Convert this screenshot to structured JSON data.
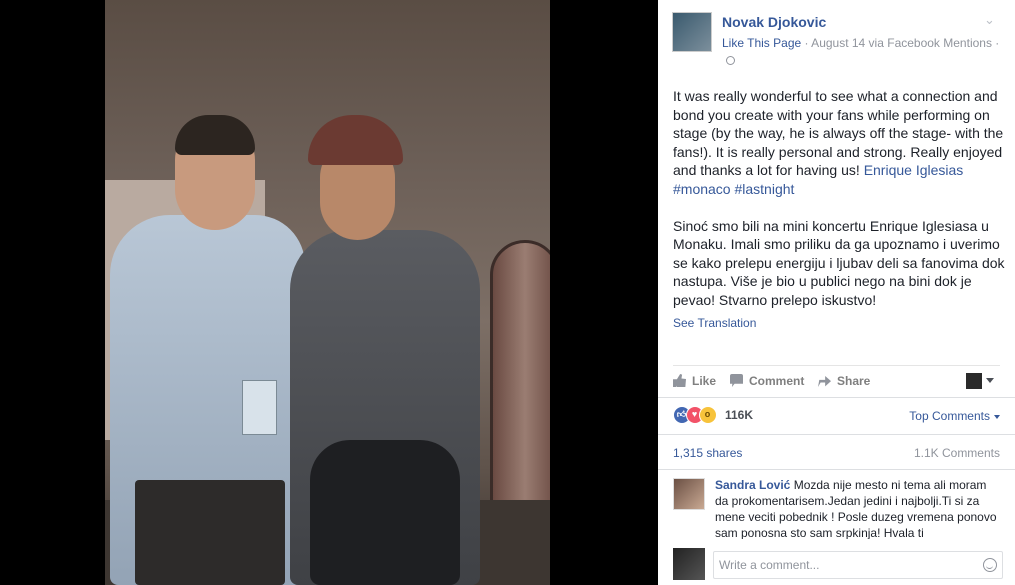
{
  "post": {
    "author": "Novak Djokovic",
    "like_page": "Like This Page",
    "meta": "· August 14 via Facebook Mentions ·",
    "text_p1_a": "It was really wonderful to see what a connection and bond you create with your fans while performing on stage (by the way, he is always off the stage- with the fans!). It is really personal and strong. Really enjoyed and thanks a lot for having us! ",
    "text_p1_link": "Enrique Iglesias #monaco #lastnight",
    "text_p2": "Sinoć smo bili na mini koncertu Enrique Iglesiasa u Monaku. Imali smo priliku da ga upoznamo i uverimo se kako prelepu energiju i ljubav deli sa fanovima dok nastupa. Više je bio u publici nego na bini dok je pevao! Stvarno prelepo iskustvo!",
    "see_translation": "See Translation"
  },
  "actions": {
    "like": "Like",
    "comment": "Comment",
    "share": "Share"
  },
  "stats": {
    "reactions_count": "116K",
    "top_comments": "Top Comments",
    "shares": "1,315 shares",
    "comments": "1.1K Comments"
  },
  "comment": {
    "author": "Sandra Lović",
    "text": " Mozda nije mesto ni tema ali moram da prokomentarisem.Jedan jedini i najbolji.Ti si za mene veciti pobednik ! Posle duzeg vremena ponovo sam ponosna sto sam srpkinja! Hvala ti"
  },
  "composer": {
    "placeholder": "Write a comment..."
  },
  "icons": {
    "reaction_like": "thumbs-up-icon",
    "reaction_love": "heart-icon",
    "reaction_wow": "wow-icon"
  },
  "colors": {
    "link": "#365899",
    "meta": "#90949c",
    "like_reaction": "#4267b2",
    "love_reaction": "#f25268",
    "wow_reaction": "#f7c33b"
  }
}
